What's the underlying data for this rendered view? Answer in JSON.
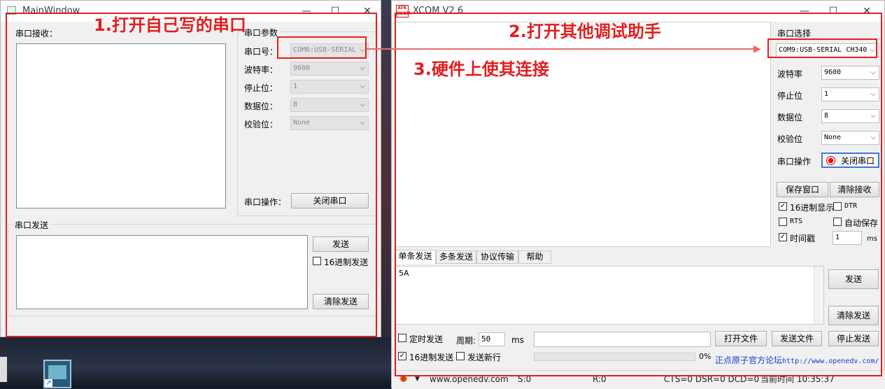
{
  "annotations": {
    "step1": "1.打开自己写的串口",
    "step2": "2.打开其他调试助手",
    "step3": "3.硬件上使其连接"
  },
  "main_window": {
    "title": "MainWindow",
    "receive_group": "串口接收：",
    "params_group": "串口参数",
    "port_label": "串口号：",
    "port_value": "COM6:USB-SERIAL",
    "baud_label": "波特率：",
    "baud_value": "9600",
    "stop_label": "停止位：",
    "stop_value": "1",
    "data_label": "数据位：",
    "data_value": "8",
    "parity_label": "校验位：",
    "parity_value": "None",
    "op_label": "串口操作：",
    "close_button": "关闭串口",
    "send_group": "串口发送",
    "send_button": "发送",
    "hex_send_label": "16进制发送",
    "clear_send_button": "清除发送"
  },
  "xcom": {
    "logo": "ATK XCOM",
    "title": "XCOM V2.6",
    "port_select_label": "串口选择",
    "port_value": "COM9:USB-SERIAL CH340",
    "baud_label": "波特率",
    "baud_value": "9600",
    "stop_label": "停止位",
    "stop_value": "1",
    "data_label": "数据位",
    "data_value": "8",
    "parity_label": "校验位",
    "parity_value": "None",
    "op_label": "串口操作",
    "close_button": "关闭串口",
    "save_window_button": "保存窗口",
    "clear_receive_button": "清除接收",
    "hex_display_label": "16进制显示",
    "dtr_label": "DTR",
    "rts_label": "RTS",
    "autosave_label": "自动保存",
    "timestamp_label": "时间戳",
    "timestamp_value": "1",
    "ms_unit": "ms",
    "tabs": [
      "单条发送",
      "多条发送",
      "协议传输",
      "帮助"
    ],
    "send_text": "5A",
    "send_button": "发送",
    "clear_send_button": "清除发送",
    "timed_send_label": "定时发送",
    "period_label": "周期:",
    "period_value": "50",
    "period_unit": "ms",
    "open_file_button": "打开文件",
    "send_file_button": "发送文件",
    "stop_send_button": "停止发送",
    "hex_send_label": "16进制发送",
    "send_newline_label": "发送新行",
    "progress_text": "0%",
    "forum_label": "正点原子官方论坛",
    "forum_url": "http://www.openedv.com/",
    "status": {
      "website": "www.openedv.com",
      "sent": "S:0",
      "received": "R:0",
      "lines": "CTS=0 DSR=0 DCD=0",
      "time": "当前时间 10:35:37"
    }
  }
}
